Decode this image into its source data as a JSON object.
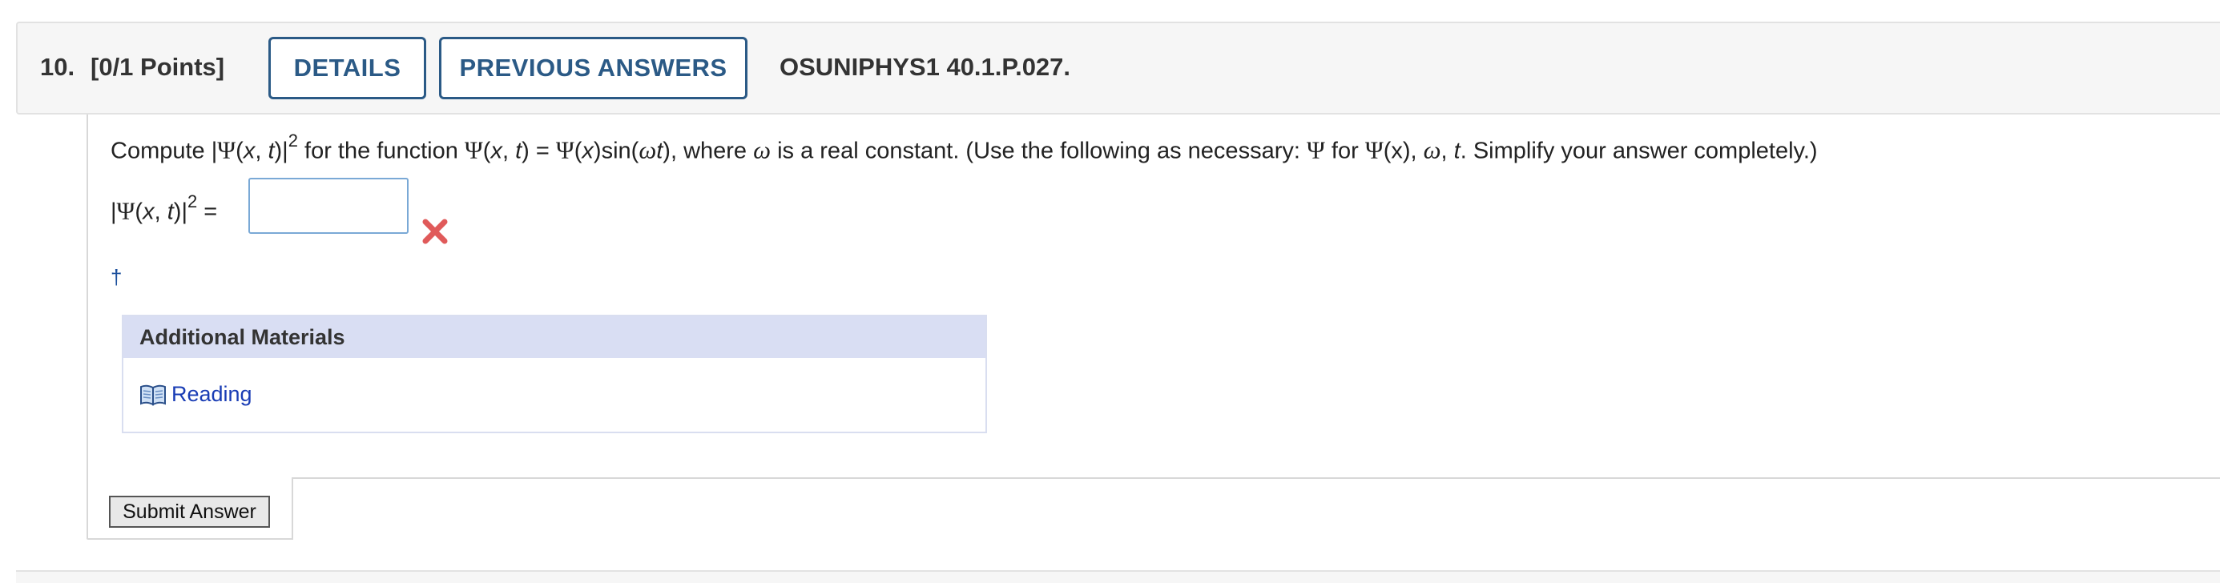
{
  "question": {
    "number": "10.",
    "points": "[0/1 Points]",
    "details_label": "DETAILS",
    "previous_answers_label": "PREVIOUS ANSWERS",
    "code": "OSUNIPHYS1 40.1.P.027."
  },
  "prompt": {
    "compute": "Compute",
    "psi": "Ψ",
    "x": "x",
    "t": "t",
    "omega": "ω",
    "sup2": "2",
    "for_the_function": "for the function",
    "sin": "sin",
    "where": "where",
    "is_real_constant": "is a real constant. (Use the following as necessary:",
    "for": "for",
    "simplify": "Simplify your answer completely.)"
  },
  "answer": {
    "value": "",
    "placeholder": "",
    "status": "incorrect"
  },
  "dagger": "†",
  "additional_materials": {
    "title": "Additional Materials",
    "items": [
      {
        "label": "Reading",
        "icon": "book-icon"
      }
    ]
  },
  "submit_label": "Submit Answer",
  "colors": {
    "accent": "#2b5a86",
    "error": "#e05a5a",
    "link": "#1a3db5",
    "materials_header": "#d9def3"
  }
}
